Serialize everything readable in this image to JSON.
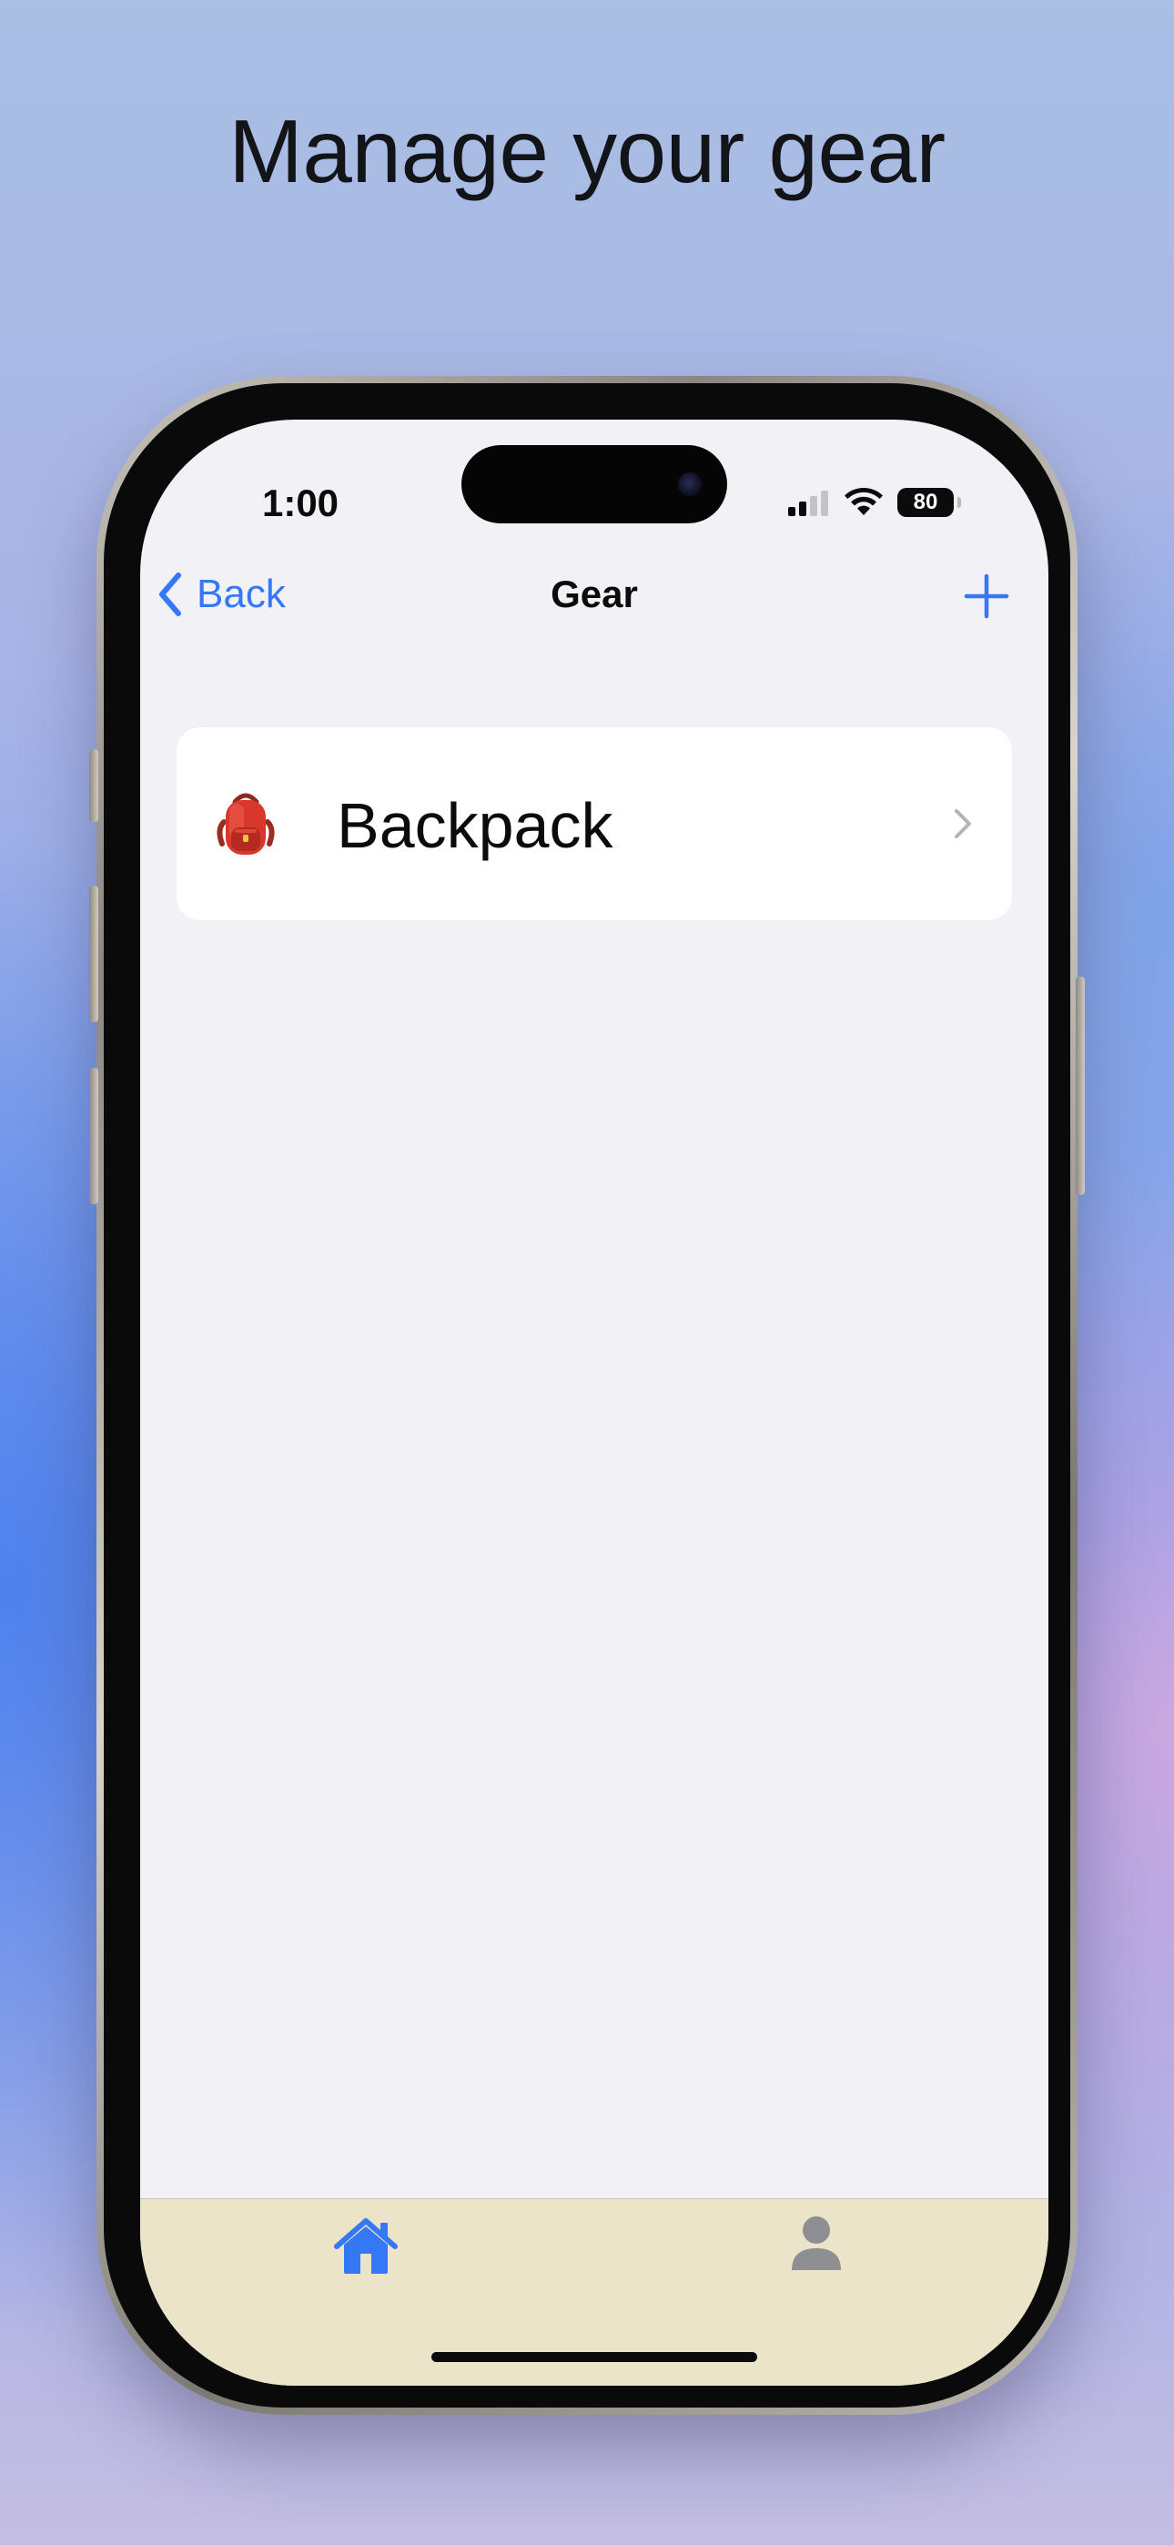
{
  "headline": "Manage your gear",
  "status_bar": {
    "time": "1:00",
    "battery_level": "80",
    "signal_bars_active": 2,
    "signal_bars_total": 4
  },
  "nav": {
    "back_label": "Back",
    "title": "Gear",
    "add_icon": "plus-icon",
    "back_icon": "chevron-left-icon"
  },
  "gear_list": {
    "items": [
      {
        "emoji": "backpack-emoji",
        "label": "Backpack",
        "chevron": "chevron-right-icon"
      }
    ]
  },
  "tab_bar": {
    "tabs": [
      {
        "icon": "house-icon",
        "selected": true
      },
      {
        "icon": "person-icon",
        "selected": false
      }
    ]
  },
  "colors": {
    "accent": "#3478f6",
    "tab_bar_background": "#ece4c8",
    "screen_background": "#f1f1f6",
    "inactive_tab": "#8e8e93"
  }
}
